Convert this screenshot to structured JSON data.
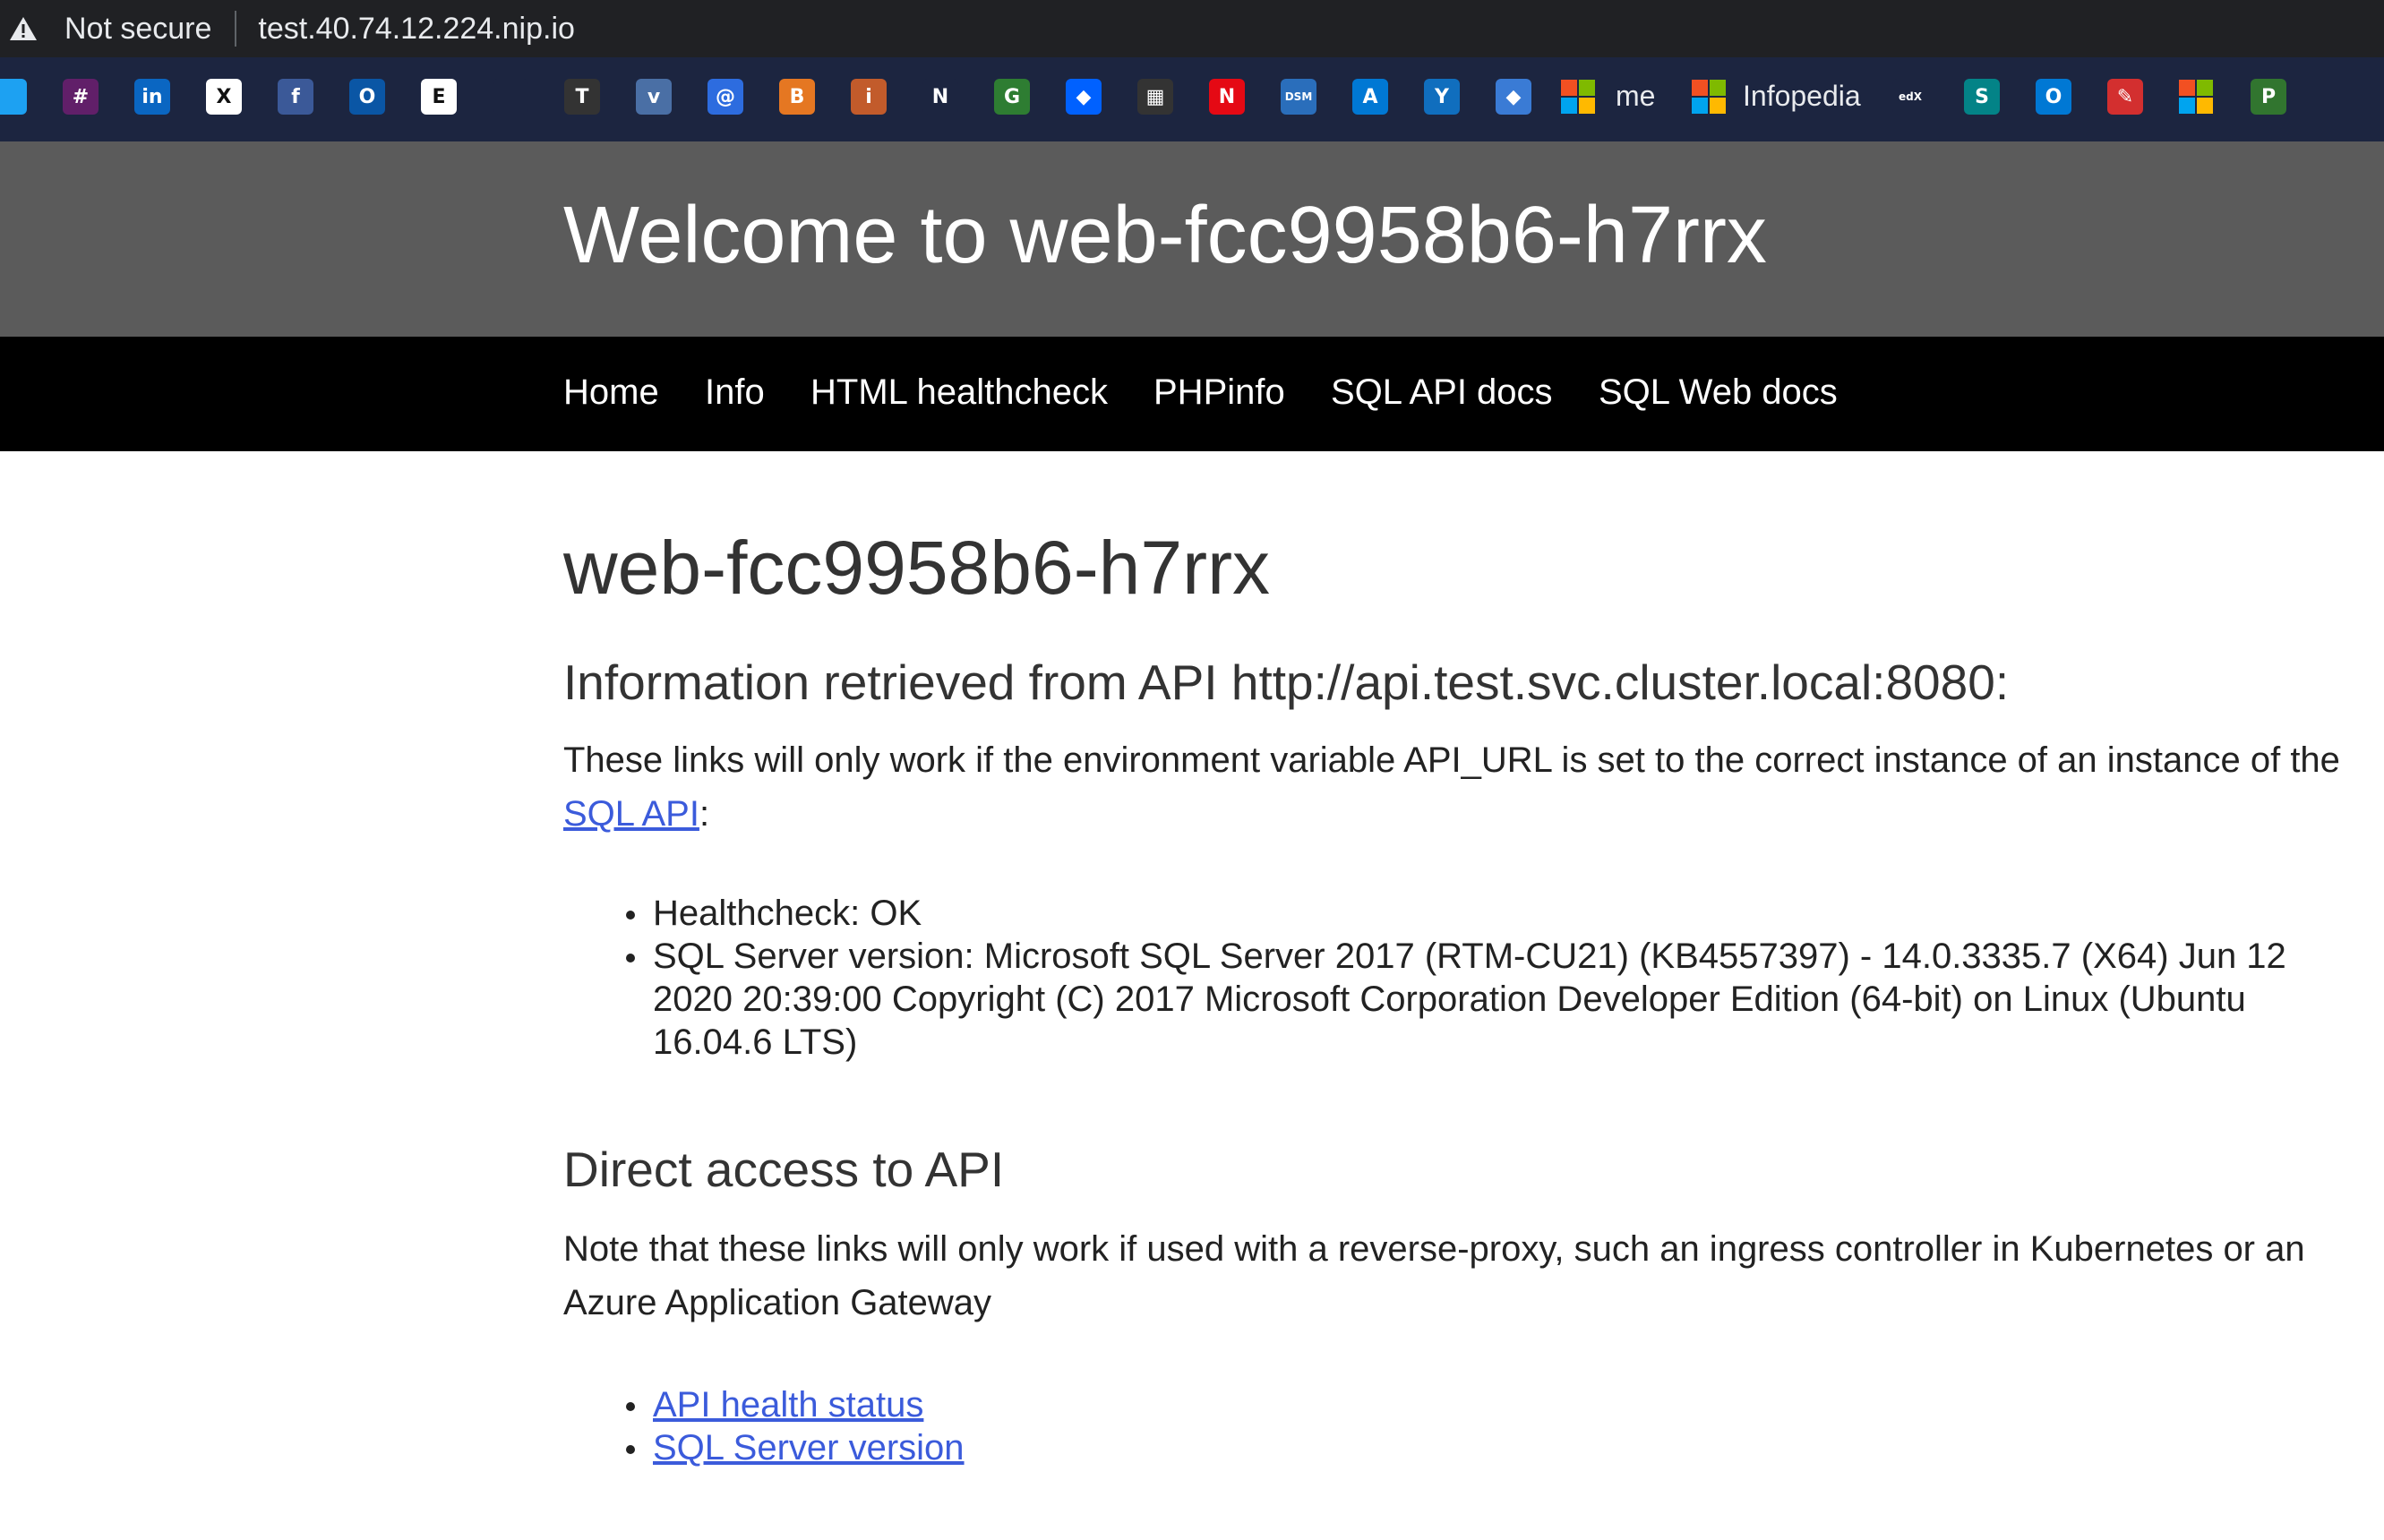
{
  "browser": {
    "security_label": "Not secure",
    "url": "test.40.74.12.224.nip.io",
    "bookmarks": [
      {
        "icon": "twitter-icon",
        "glyph": "",
        "color": "#1da1f2"
      },
      {
        "icon": "slack-icon",
        "glyph": "#",
        "color": "#611f69"
      },
      {
        "icon": "linkedin-icon",
        "glyph": "in",
        "color": "#0a66c2"
      },
      {
        "icon": "xing-icon",
        "glyph": "X",
        "color": "#ffffff"
      },
      {
        "icon": "facebook-icon",
        "glyph": "f",
        "color": "#3b5998"
      },
      {
        "icon": "ring-icon",
        "glyph": "O",
        "color": "#0a56a5"
      },
      {
        "icon": "e-letter-icon",
        "glyph": "E",
        "color": "#ffffff"
      },
      {
        "icon": "blank-icon",
        "glyph": "",
        "color": "#1c2540"
      },
      {
        "icon": "nyt-icon",
        "glyph": "T",
        "color": "#333333"
      },
      {
        "icon": "check-icon",
        "glyph": "v",
        "color": "#4a6fa5"
      },
      {
        "icon": "swirl-icon",
        "glyph": "@",
        "color": "#2d6cdf"
      },
      {
        "icon": "orange-book-icon",
        "glyph": "B",
        "color": "#e57722"
      },
      {
        "icon": "figure-icon",
        "glyph": "i",
        "color": "#c25b2b"
      },
      {
        "icon": "n-letter-icon",
        "glyph": "N",
        "color": "#1c2540"
      },
      {
        "icon": "gauge-icon",
        "glyph": "G",
        "color": "#2e7d32"
      },
      {
        "icon": "dropbox-icon",
        "glyph": "◆",
        "color": "#0061ff"
      },
      {
        "icon": "store-icon",
        "glyph": "▦",
        "color": "#333333"
      },
      {
        "icon": "netflix-icon",
        "glyph": "N",
        "color": "#e50914"
      },
      {
        "icon": "dsm-icon",
        "glyph": "DSM",
        "color": "#2a6ebb"
      },
      {
        "icon": "azure-icon",
        "glyph": "A",
        "color": "#0078d4"
      },
      {
        "icon": "yammer-icon",
        "glyph": "Y",
        "color": "#106ebe"
      },
      {
        "icon": "diamond-icon",
        "glyph": "◆",
        "color": "#3a7bd5"
      }
    ],
    "bookmark_me": "me",
    "bookmark_infopedia": "Infopedia",
    "bookmarks_tail": [
      {
        "icon": "edx-icon",
        "glyph": "edX",
        "color": "#1c2540"
      },
      {
        "icon": "sharepoint-icon",
        "glyph": "S",
        "color": "#038387"
      },
      {
        "icon": "outlook-icon",
        "glyph": "O",
        "color": "#0078d4"
      },
      {
        "icon": "pin-icon",
        "glyph": "✎",
        "color": "#d32f2f"
      },
      {
        "icon": "microsoft-icon",
        "glyph": "",
        "color": ""
      },
      {
        "icon": "planner-icon",
        "glyph": "P",
        "color": "#31752f"
      }
    ]
  },
  "header": {
    "title": "Welcome to web-fcc9958b6-h7rrx"
  },
  "nav": {
    "items": [
      "Home",
      "Info",
      "HTML healthcheck",
      "PHPinfo",
      "SQL API docs",
      "SQL Web docs"
    ]
  },
  "main": {
    "hostname": "web-fcc9958b6-h7rrx",
    "api_heading": "Information retrieved from API http://api.test.svc.cluster.local:8080:",
    "api_desc_text": "These links will only work if the environment variable API_URL is set to the correct instance of an instance of the ",
    "api_desc_link": "SQL API",
    "api_desc_suffix": ":",
    "info_items": [
      "Healthcheck: OK",
      "SQL Server version: Microsoft SQL Server 2017 (RTM-CU21) (KB4557397) - 14.0.3335.7 (X64) Jun 12 2020 20:39:00 Copyright (C) 2017 Microsoft Corporation Developer Edition (64-bit) on Linux (Ubuntu 16.04.6 LTS)"
    ],
    "direct_heading": "Direct access to API",
    "direct_desc": "Note that these links will only work if used with a reverse-proxy, such an ingress controller in Kubernetes or an Azure Application Gateway",
    "direct_links": [
      "API health status",
      "SQL Server version"
    ]
  }
}
